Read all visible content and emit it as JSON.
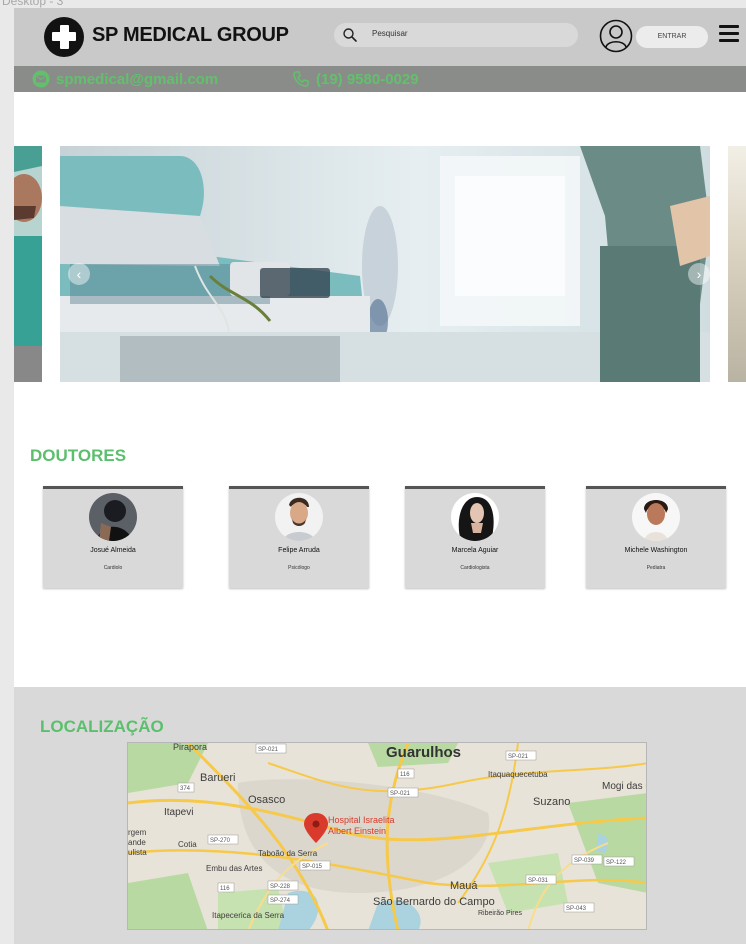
{
  "frame": {
    "label": "Desktop - 3"
  },
  "header": {
    "brand": "SP MEDICAL GROUP",
    "search_placeholder": "Pesquisar",
    "login_label": "ENTRAR",
    "icons": [
      "medical-cross-logo-icon",
      "search-icon",
      "user-icon",
      "menu-icon"
    ]
  },
  "contact": {
    "email": "spmedical@gmail.com",
    "phone": "(19) 9580-0029",
    "icons": [
      "email-icon",
      "phone-icon"
    ]
  },
  "carousel": {
    "prev_icon": "chevron-left-icon",
    "next_icon": "chevron-right-icon"
  },
  "doctors": {
    "title": "DOUTORES",
    "items": [
      {
        "name": "Josué Almeida",
        "specialty": "Cardiolo"
      },
      {
        "name": "Felipe Arruda",
        "specialty": "Psicólogo"
      },
      {
        "name": "Marcela Aguiar",
        "specialty": "Cardiologista"
      },
      {
        "name": "Michele Washington",
        "specialty": "Pediatra"
      }
    ]
  },
  "location": {
    "title": "LOCALIZAÇÃO",
    "map": {
      "cities": [
        "Guarulhos",
        "Barueri",
        "Osasco",
        "Itapevi",
        "Suzano",
        "Mogi das Cruzes",
        "Itaquaquecetuba",
        "Cotia",
        "Embu das Artes",
        "Taboão da Serra",
        "Mauá",
        "São Bernardo do Campo",
        "Ribeirão Pires",
        "Itapecerica da Serra",
        "Pirapora"
      ],
      "marker_label_1": "Hospital Israelita",
      "marker_label_2": "Albert Einstein",
      "edge_text": [
        "rgem",
        "ande",
        "ulista"
      ],
      "road_shields": [
        "SP-021",
        "SP-021",
        "SP-021",
        "SP-070",
        "SP-270",
        "SP-015",
        "SP-228",
        "SP-274",
        "SP-031",
        "SP-039",
        "SP-122",
        "SP-043",
        "116",
        "116",
        "374"
      ],
      "colors": {
        "marker": "#d93a2b",
        "road": "#f6c94a",
        "water": "#aad3df",
        "land": "#e8e3d8",
        "park": "#b9d9a2"
      }
    }
  },
  "colors": {
    "accent_green": "#5cbf6d",
    "header_bg": "#c9c9c9",
    "contact_bg": "#8a8c89",
    "card_bg": "#d9d9d9"
  }
}
